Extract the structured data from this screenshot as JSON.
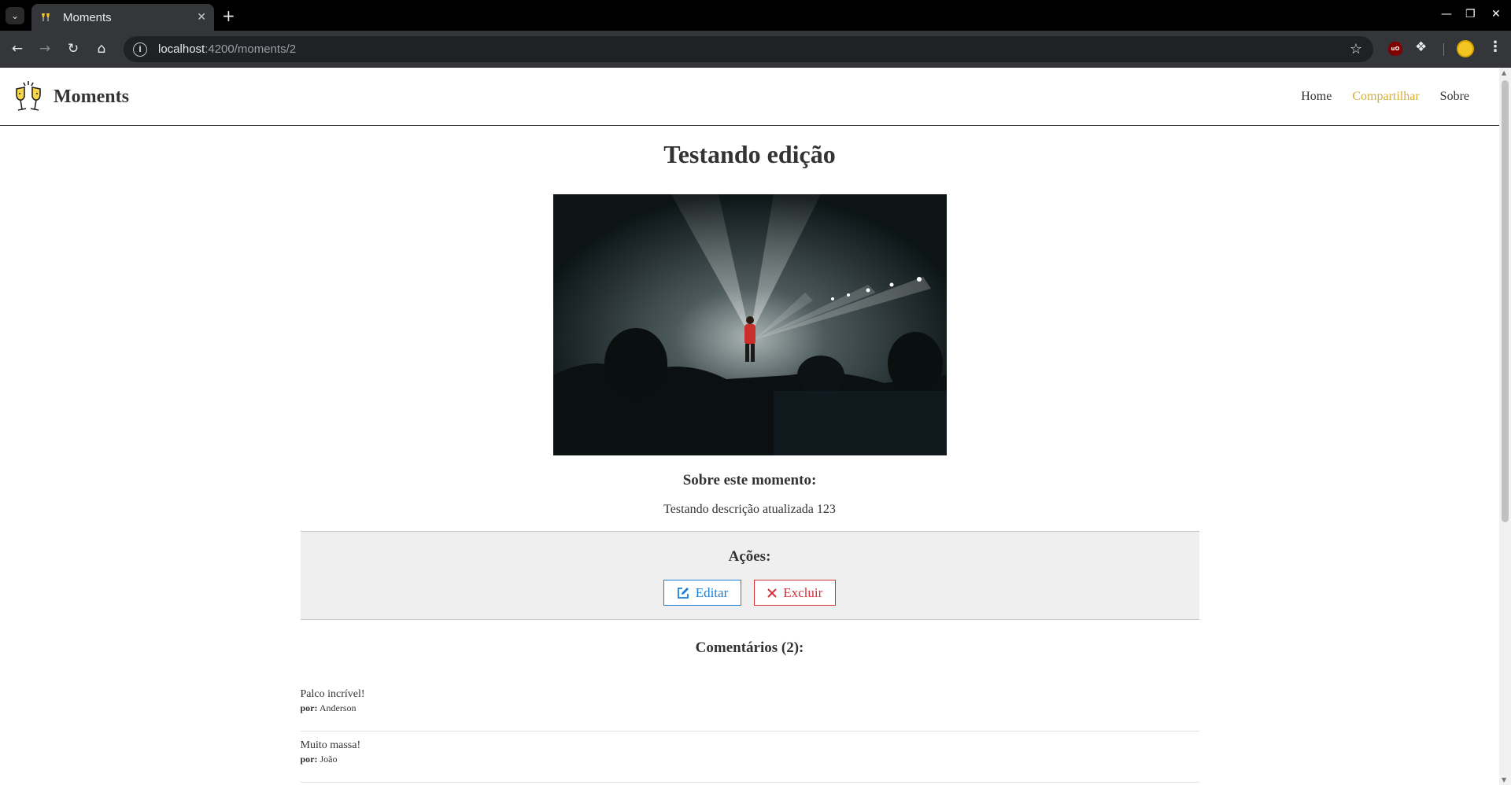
{
  "browser": {
    "tab_title": "Moments",
    "new_tab": "+",
    "tab_close": "✕",
    "url_host": "localhost",
    "url_path": ":4200/moments/2",
    "ublock_label": "uO"
  },
  "site": {
    "brand": "Moments",
    "nav": [
      {
        "label": "Home"
      },
      {
        "label": "Compartilhar"
      },
      {
        "label": "Sobre"
      }
    ],
    "accent_color": "#d4af37"
  },
  "moment": {
    "title": "Testando edição",
    "about_title": "Sobre este momento:",
    "description": "Testando descrição atualizada 123"
  },
  "actions": {
    "title": "Ações:",
    "edit_label": "Editar",
    "delete_label": "Excluir",
    "edit_color": "#1a7fd6",
    "delete_color": "#d6303a"
  },
  "comments": {
    "title": "Comentários (2):",
    "author_prefix": "por:",
    "items": [
      {
        "text": "Palco incrível!",
        "author": "Anderson"
      },
      {
        "text": "Muito massa!",
        "author": "João"
      }
    ]
  }
}
